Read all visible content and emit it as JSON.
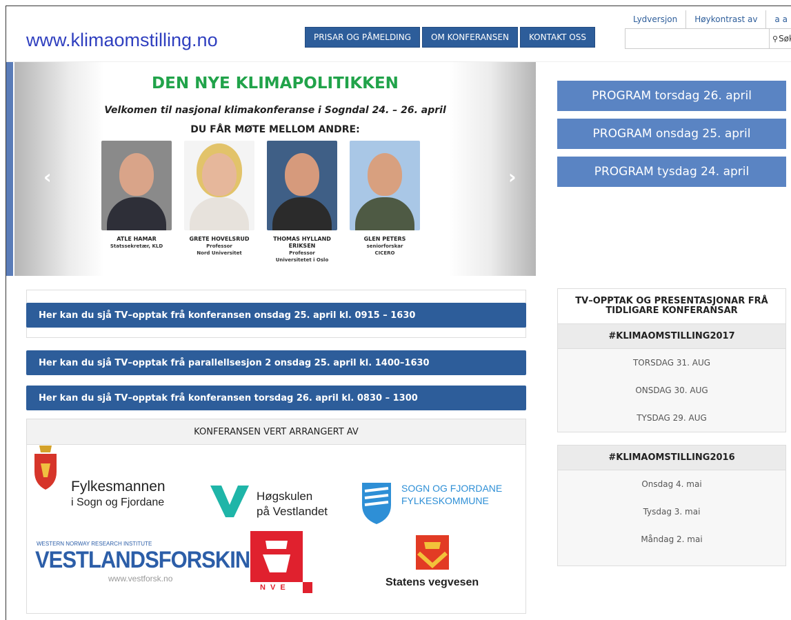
{
  "header": {
    "site_url": "www.klimaomstilling.no",
    "nav": [
      "PRISAR OG PÅMELDING",
      "OM KONFERANSEN",
      "KONTAKT OSS"
    ],
    "util_links": [
      "Lydversjon",
      "Høykontrast av",
      "a a"
    ],
    "search_button": "Søk"
  },
  "slider": {
    "title": "DEN NYE KLIMAPOLITIKKEN",
    "subtitle": "Velkomen til nasjonal klimakonferanse i Sogndal 24. – 26. april",
    "subtitle2": "DU FÅR MØTE MELLOM ANDRE:",
    "prev_icon": "‹",
    "next_icon": "›",
    "speakers": [
      {
        "name": "ATLE HAMAR",
        "role1": "Statssekretær, KLD",
        "role2": ""
      },
      {
        "name": "GRETE HOVELSRUD",
        "role1": "Professor",
        "role2": "Nord Universitet"
      },
      {
        "name": "THOMAS HYLLAND ERIKSEN",
        "role1": "Professor",
        "role2": "Universitetet i Oslo"
      },
      {
        "name": "GLEN PETERS",
        "role1": "seniorforskar",
        "role2": "CICERO"
      }
    ]
  },
  "program_buttons": [
    "PROGRAM torsdag 26. april",
    "PROGRAM onsdag 25. april",
    "PROGRAM tysdag 24. april"
  ],
  "tv_links": [
    "Her kan du sjå TV–opptak frå konferansen onsdag 25. april kl. 0915 – 1630",
    "Her kan du sjå TV–opptak frå parallellsesjon 2 onsdag 25. april kl. 1400–1630",
    "Her kan du sjå TV–opptak frå konferansen torsdag 26. april kl. 0830 – 1300"
  ],
  "arrangers": {
    "heading": "KONFERANSEN VERT ARRANGERT AV",
    "fylkesmannen_1": "Fylkesmannen",
    "fylkesmannen_2": "i Sogn og Fjordane",
    "hvl_1": "Høgskulen",
    "hvl_2": "på Vestlandet",
    "sfj_1": "SOGN OG FJORDANE",
    "sfj_2": "FYLKESKOMMUNE",
    "vf_small": "WESTERN NORWAY RESEARCH INSTITUTE",
    "vf_big": "VESTLANDSFORSKING",
    "vf_url": "www.vestforsk.no",
    "nve": "N V E",
    "svv": "Statens vegvesen"
  },
  "sidebar": {
    "title": "TV–OPPTAK OG PRESENTASJONAR FRÅ TIDLIGARE KONFERANSAR",
    "groups": [
      {
        "heading": "#KLIMAOMSTILLING2017",
        "items": [
          "TORSDAG 31. AUG",
          "ONSDAG 30. AUG",
          "TYSDAG 29. AUG"
        ]
      },
      {
        "heading": "#KLIMAOMSTILLING2016",
        "items": [
          "Onsdag 4. mai",
          "Tysdag 3. mai",
          "Måndag 2. mai"
        ]
      }
    ]
  },
  "colors": {
    "nav": "#2d5d9a",
    "program": "#5a84c3",
    "green": "#21a34a",
    "url": "#2f3fbf"
  }
}
